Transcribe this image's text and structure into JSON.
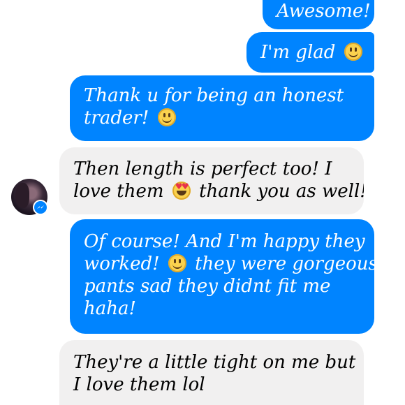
{
  "conversation": {
    "messages": [
      {
        "sender": "me",
        "lines": [
          [
            "Awesome!"
          ]
        ]
      },
      {
        "sender": "me",
        "lines": [
          [
            "I'm glad ",
            "smiley-emoji"
          ]
        ]
      },
      {
        "sender": "me",
        "lines": [
          [
            "Thank u for being an honest"
          ],
          [
            "trader!  ",
            "smiley-emoji"
          ]
        ]
      },
      {
        "sender": "them",
        "lines": [
          [
            "Then length is perfect too! I"
          ],
          [
            "love them ",
            "heart-eyes-emoji",
            " thank you as well!"
          ]
        ]
      },
      {
        "sender": "me",
        "lines": [
          [
            "Of course! And I'm happy they"
          ],
          [
            "worked! ",
            "smiley-emoji",
            " they were gorgeous"
          ],
          [
            "pants sad they didnt fit me"
          ],
          [
            "haha!"
          ]
        ]
      },
      {
        "sender": "them",
        "lines": [
          [
            "They're a little tight on me but"
          ],
          [
            "I love them lol"
          ]
        ]
      }
    ]
  },
  "colors": {
    "outgoing_bubble": "#0084ff",
    "incoming_bubble": "#f1f0f0",
    "outgoing_text": "#ffffff",
    "incoming_text": "#000000",
    "messenger_badge": "#0084ff"
  },
  "contact": {
    "avatar_icon": "contact-avatar",
    "badge_icon": "messenger-icon"
  }
}
